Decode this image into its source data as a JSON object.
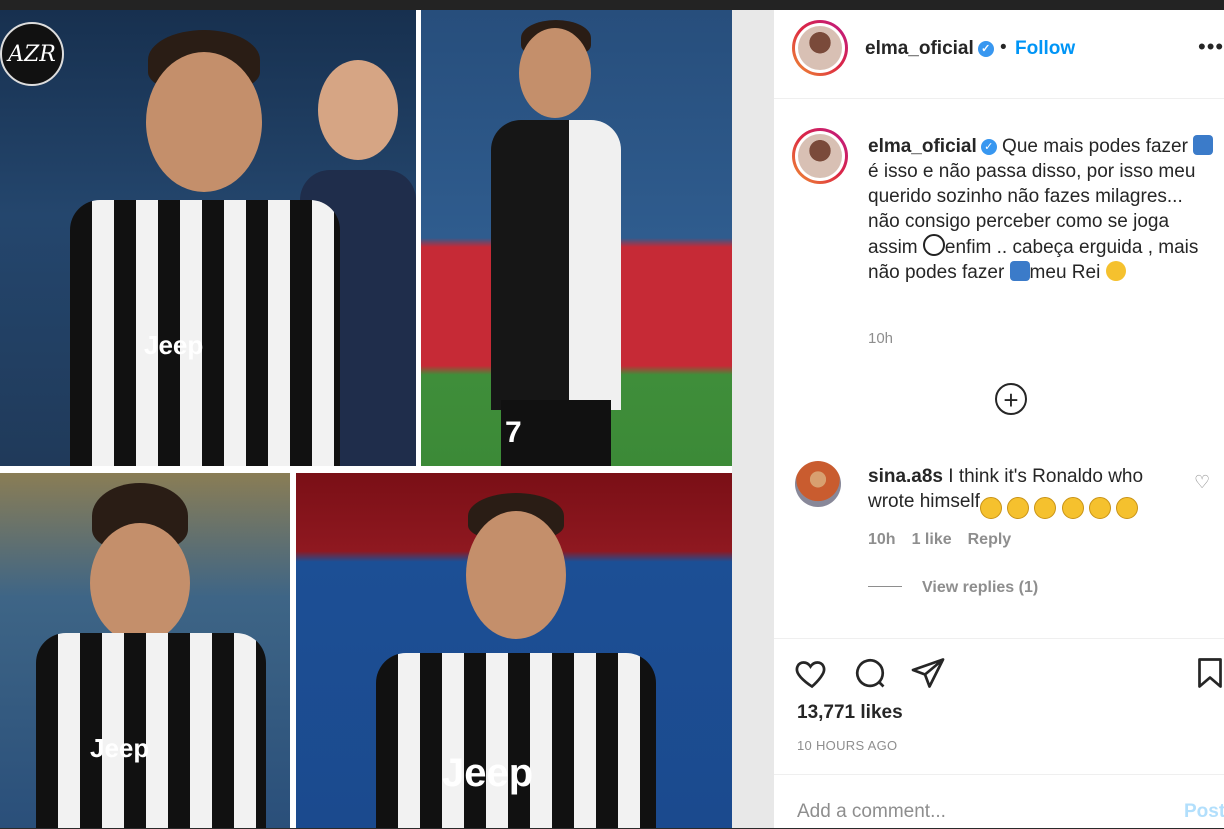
{
  "media": {
    "watermark_text": "AZR",
    "photos": [
      {
        "name": "photo-1",
        "jersey_text": "Jeep"
      },
      {
        "name": "photo-2",
        "jersey_number": "7"
      },
      {
        "name": "photo-3",
        "jersey_text": "Jeep"
      },
      {
        "name": "photo-4",
        "jersey_text": "Jeep"
      }
    ]
  },
  "header": {
    "username": "elma_oficial",
    "verified_icon": "✓",
    "separator": "•",
    "follow_label": "Follow",
    "more_icon": "•••"
  },
  "caption": {
    "username": "elma_oficial",
    "text_1": " Que mais podes fazer ",
    "text_2": "é isso e não passa disso, por isso meu querido sozinho não fazes milagres... não consigo perceber como se joga assim ",
    "text_3": "enfim .. cabeça erguida , mais não podes fazer ",
    "text_4": "meu Rei ",
    "time": "10h"
  },
  "load_more_icon": "+",
  "comment": {
    "username": "sina.a8s",
    "text": " I think it's Ronaldo who wrote himself",
    "emojis": [
      "😂",
      "😂",
      "😂",
      "😂",
      "😂",
      "🤣"
    ],
    "time": "10h",
    "likes": "1 like",
    "reply_label": "Reply",
    "view_replies": "View replies (1)"
  },
  "actions": {
    "likes": "13,771 likes",
    "ago": "10 HOURS AGO"
  },
  "add_comment": {
    "placeholder": "Add a comment...",
    "post_label": "Post"
  },
  "colors": {
    "link_blue": "#0095f6",
    "verified_blue": "#3897f0",
    "muted": "#8e8e8e"
  }
}
